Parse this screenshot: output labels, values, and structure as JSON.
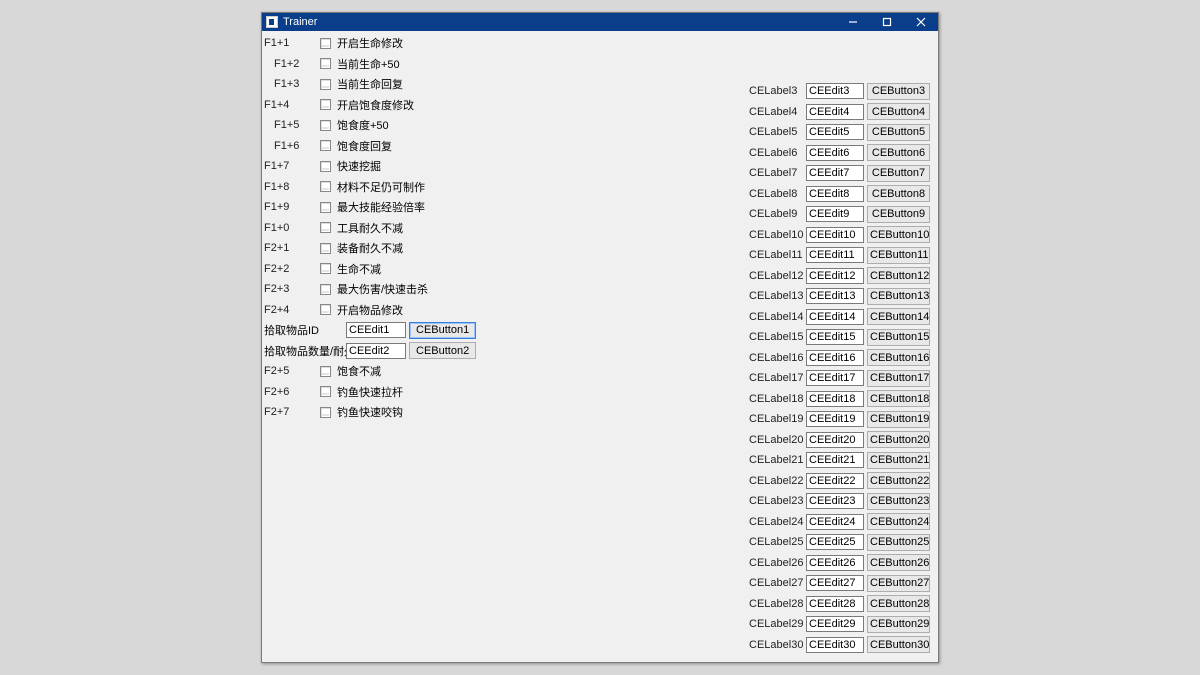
{
  "titlebar": {
    "title": "Trainer"
  },
  "left": {
    "items": [
      {
        "hk": "F1+1",
        "indent": false,
        "label": "开启生命修改"
      },
      {
        "hk": "F1+2",
        "indent": true,
        "label": "当前生命+50"
      },
      {
        "hk": "F1+3",
        "indent": true,
        "label": "当前生命回复"
      },
      {
        "hk": "F1+4",
        "indent": false,
        "label": "开启饱食度修改"
      },
      {
        "hk": "F1+5",
        "indent": true,
        "label": "饱食度+50"
      },
      {
        "hk": "F1+6",
        "indent": true,
        "label": "饱食度回复"
      },
      {
        "hk": "F1+7",
        "indent": false,
        "label": "快速挖掘"
      },
      {
        "hk": "F1+8",
        "indent": false,
        "label": "材料不足仍可制作"
      },
      {
        "hk": "F1+9",
        "indent": false,
        "label": "最大技能经验倍率"
      },
      {
        "hk": "F1+0",
        "indent": false,
        "label": "工具耐久不减"
      },
      {
        "hk": "F2+1",
        "indent": false,
        "label": "装备耐久不减"
      },
      {
        "hk": "F2+2",
        "indent": false,
        "label": "生命不减"
      },
      {
        "hk": "F2+3",
        "indent": false,
        "label": "最大伤害/快速击杀"
      },
      {
        "hk": "F2+4",
        "indent": false,
        "label": "开启物品修改"
      }
    ],
    "pick_id_label": "拾取物品ID",
    "pick_qty_label": "拾取物品数量/耐久",
    "edit1": "CEEdit1",
    "edit2": "CEEdit2",
    "btn1": "CEButton1",
    "btn2": "CEButton2",
    "items2": [
      {
        "hk": "F2+5",
        "label": "饱食不减"
      },
      {
        "hk": "F2+6",
        "label": "钓鱼快速拉杆"
      },
      {
        "hk": "F2+7",
        "label": "钓鱼快速咬钩"
      }
    ]
  },
  "right": {
    "rows": [
      {
        "label": "CELabel3",
        "edit": "CEEdit3",
        "btn": "CEButton3"
      },
      {
        "label": "CELabel4",
        "edit": "CEEdit4",
        "btn": "CEButton4"
      },
      {
        "label": "CELabel5",
        "edit": "CEEdit5",
        "btn": "CEButton5"
      },
      {
        "label": "CELabel6",
        "edit": "CEEdit6",
        "btn": "CEButton6"
      },
      {
        "label": "CELabel7",
        "edit": "CEEdit7",
        "btn": "CEButton7"
      },
      {
        "label": "CELabel8",
        "edit": "CEEdit8",
        "btn": "CEButton8"
      },
      {
        "label": "CELabel9",
        "edit": "CEEdit9",
        "btn": "CEButton9"
      },
      {
        "label": "CELabel10",
        "edit": "CEEdit10",
        "btn": "CEButton10"
      },
      {
        "label": "CELabel11",
        "edit": "CEEdit11",
        "btn": "CEButton11"
      },
      {
        "label": "CELabel12",
        "edit": "CEEdit12",
        "btn": "CEButton12"
      },
      {
        "label": "CELabel13",
        "edit": "CEEdit13",
        "btn": "CEButton13"
      },
      {
        "label": "CELabel14",
        "edit": "CEEdit14",
        "btn": "CEButton14"
      },
      {
        "label": "CELabel15",
        "edit": "CEEdit15",
        "btn": "CEButton15"
      },
      {
        "label": "CELabel16",
        "edit": "CEEdit16",
        "btn": "CEButton16"
      },
      {
        "label": "CELabel17",
        "edit": "CEEdit17",
        "btn": "CEButton17"
      },
      {
        "label": "CELabel18",
        "edit": "CEEdit18",
        "btn": "CEButton18"
      },
      {
        "label": "CELabel19",
        "edit": "CEEdit19",
        "btn": "CEButton19"
      },
      {
        "label": "CELabel20",
        "edit": "CEEdit20",
        "btn": "CEButton20"
      },
      {
        "label": "CELabel21",
        "edit": "CEEdit21",
        "btn": "CEButton21"
      },
      {
        "label": "CELabel22",
        "edit": "CEEdit22",
        "btn": "CEButton22"
      },
      {
        "label": "CELabel23",
        "edit": "CEEdit23",
        "btn": "CEButton23"
      },
      {
        "label": "CELabel24",
        "edit": "CEEdit24",
        "btn": "CEButton24"
      },
      {
        "label": "CELabel25",
        "edit": "CEEdit25",
        "btn": "CEButton25"
      },
      {
        "label": "CELabel26",
        "edit": "CEEdit26",
        "btn": "CEButton26"
      },
      {
        "label": "CELabel27",
        "edit": "CEEdit27",
        "btn": "CEButton27"
      },
      {
        "label": "CELabel28",
        "edit": "CEEdit28",
        "btn": "CEButton28"
      },
      {
        "label": "CELabel29",
        "edit": "CEEdit29",
        "btn": "CEButton29"
      },
      {
        "label": "CELabel30",
        "edit": "CEEdit30",
        "btn": "CEButton30"
      }
    ]
  }
}
